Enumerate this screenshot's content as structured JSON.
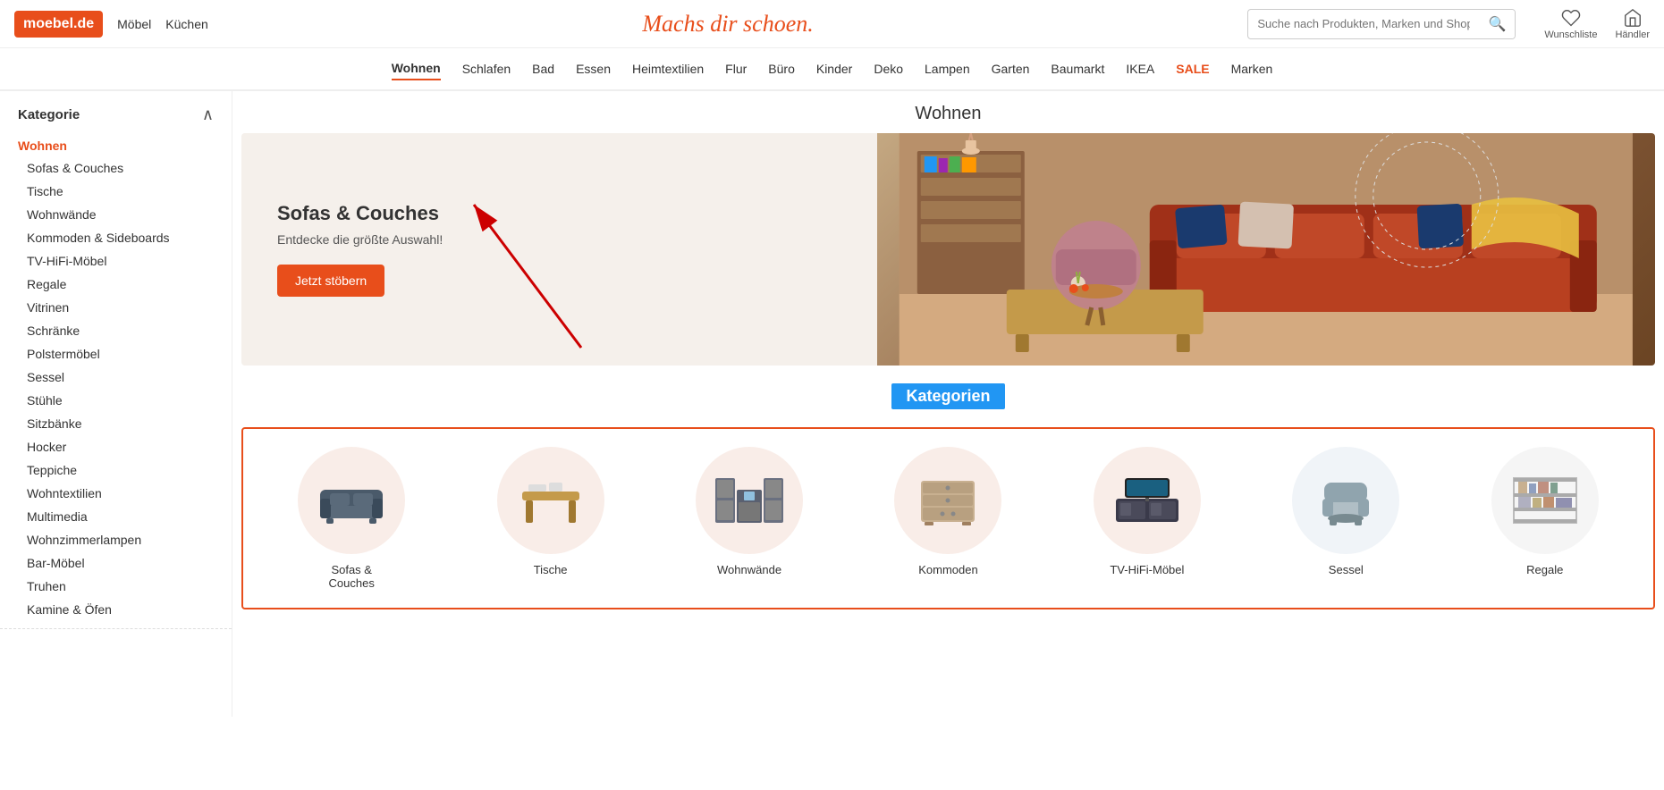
{
  "header": {
    "logo": "moebel.de",
    "nav_links": [
      "Möbel",
      "Küchen"
    ],
    "brand_title": "Machs dir schoen.",
    "search_placeholder": "Suche nach Produkten, Marken und Shops",
    "wishlist_label": "Wunschliste",
    "haendler_label": "Händler"
  },
  "main_nav": {
    "items": [
      {
        "label": "Wohnen",
        "active": true
      },
      {
        "label": "Schlafen"
      },
      {
        "label": "Bad"
      },
      {
        "label": "Essen"
      },
      {
        "label": "Heimtextilien"
      },
      {
        "label": "Flur"
      },
      {
        "label": "Büro"
      },
      {
        "label": "Kinder"
      },
      {
        "label": "Deko"
      },
      {
        "label": "Lampen"
      },
      {
        "label": "Garten"
      },
      {
        "label": "Baumarkt"
      },
      {
        "label": "IKEA"
      },
      {
        "label": "SALE",
        "sale": true
      },
      {
        "label": "Marken"
      }
    ]
  },
  "sidebar": {
    "title": "Kategorie",
    "active_item": "Wohnen",
    "items": [
      "Sofas & Couches",
      "Tische",
      "Wohnwände",
      "Kommoden & Sideboards",
      "TV-HiFi-Möbel",
      "Regale",
      "Vitrinen",
      "Schränke",
      "Polstermöbel",
      "Sessel",
      "Stühle",
      "Sitzbänke",
      "Hocker",
      "Teppiche",
      "Wohntextilien",
      "Multimedia",
      "Wohnzimmerlampen",
      "Bar-Möbel",
      "Truhen",
      "Kamine & Öfen"
    ]
  },
  "page": {
    "heading": "Wohnen"
  },
  "hero": {
    "title": "Sofas & Couches",
    "subtitle": "Entdecke die größte Auswahl!",
    "btn_label": "Jetzt stöbern"
  },
  "kategorien": {
    "section_title": "Kategorien",
    "items": [
      {
        "label": "Sofas &\nCouches",
        "icon": "sofa"
      },
      {
        "label": "Tische",
        "icon": "table"
      },
      {
        "label": "Wohnwände",
        "icon": "wall-unit"
      },
      {
        "label": "Kommoden",
        "icon": "dresser"
      },
      {
        "label": "TV-HiFi-Möbel",
        "icon": "tv-unit"
      },
      {
        "label": "Sessel",
        "icon": "armchair"
      },
      {
        "label": "Regale",
        "icon": "shelf"
      }
    ]
  },
  "detected": {
    "sofas_text": "Sofas",
    "sofas_couches_text": "Sofas Couches"
  }
}
